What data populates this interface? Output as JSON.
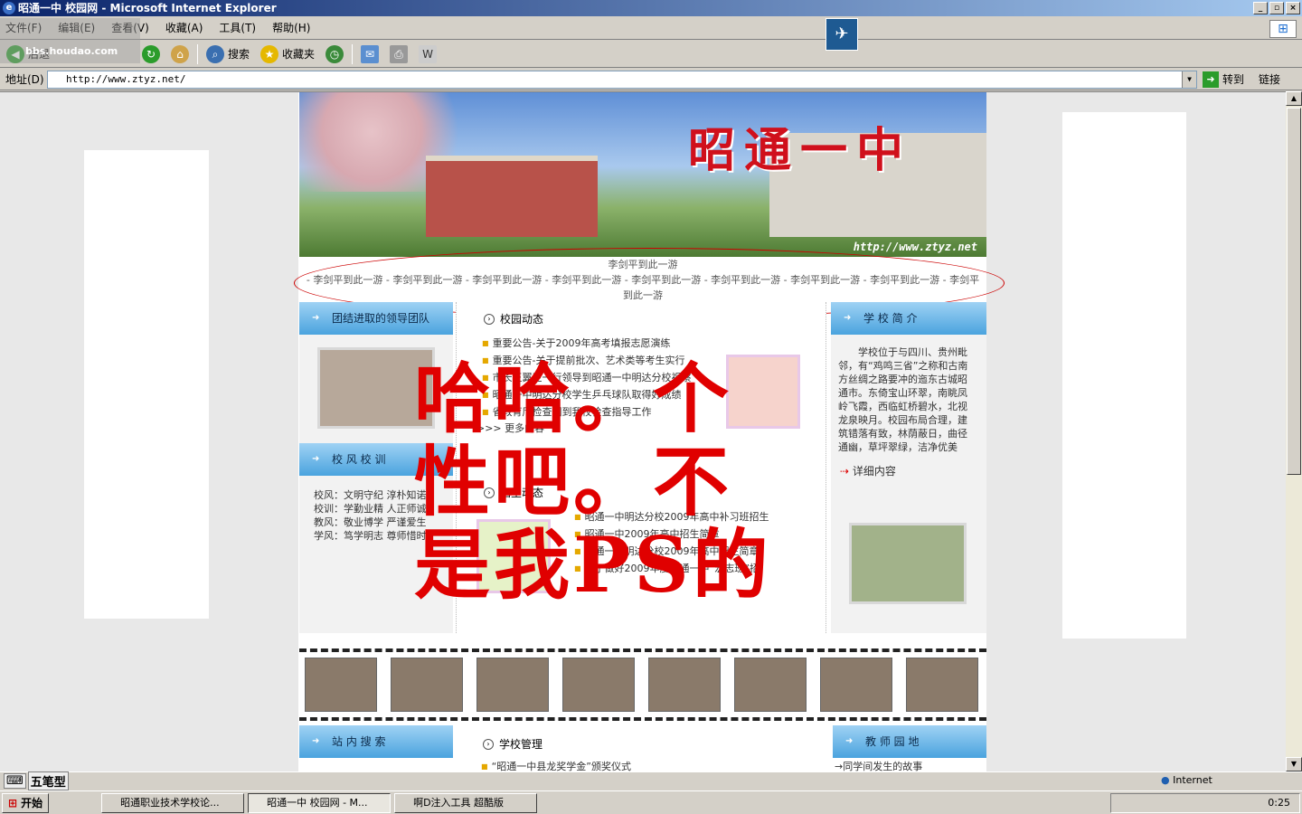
{
  "window": {
    "title": "昭通一中 校园网 - Microsoft Internet Explorer"
  },
  "menu": [
    "文件(F)",
    "编辑(E)",
    "查看(V)",
    "收藏(A)",
    "工具(T)",
    "帮助(H)"
  ],
  "toolbar": {
    "back": "后退",
    "search": "搜索",
    "favorites": "收藏夹"
  },
  "watermark": "bbs.houdao.com",
  "address": {
    "label": "地址(D)",
    "url": "http://www.ztyz.net/",
    "go": "转到",
    "links": "链接"
  },
  "site": {
    "banner_title": "昭通一中",
    "banner_url": "http://www.ztyz.net",
    "marquee_line1": "李剑平到此一游",
    "marquee_line2": "- 李剑平到此一游 - 李剑平到此一游 - 李剑平到此一游 - 李剑平到此一游 - 李剑平到此一游 - 李剑平到此一游 - 李剑平到此一游 - 李剑平到此一游 - 李剑平到此一游",
    "left": {
      "leaders": "团结进取的领导团队",
      "motto_title": "校 风 校 训",
      "motto": [
        "校风：文明守纪 淳朴知诺",
        "校训：学勤业精 人正师诚",
        "教风：敬业博学 严谨爱生",
        "学风：笃学明志 尊师惜时"
      ],
      "search": "站 内 搜 索"
    },
    "middle": {
      "campus_news": "校园动态",
      "news": [
        "重要公告-关于2009年高考填报志愿演练",
        "重要公告-关于提前批次、艺术类等考生实行",
        "市长王翼卫一行领导到昭通一中明达分校视察",
        "昭通一中明达分校学生乒乓球队取得好成绩",
        "省教育厅检查团到我校检查指导工作"
      ],
      "more": ">>> 更多内容",
      "admission": "招生动态",
      "admission_news": [
        "昭通一中明达分校2009年高中补习班招生",
        "昭通一中2009年高中招生简章",
        "昭通一中明达分校2009年高中招生简章",
        "关于做好2009年度昭通一中“宏志班”招"
      ],
      "management": "学校管理",
      "management_news": [
        "“昭通一中县龙奖学金”颁奖仪式"
      ]
    },
    "right": {
      "intro_title": "学 校 简 介",
      "intro": "学校位于与四川、贵州毗邻，有“鸡鸣三省”之称和古南方丝绸之路要冲的迤东古城昭通市。东倚宝山环翠，南眺凤岭飞霞，西临虹桥碧水，北视龙泉映月。校园布局合理，建筑错落有致，林荫蔽日，曲径通幽，草坪翠绿，洁净优美",
      "detail": "详细内容",
      "teachers": "教 师 园 地",
      "teacher_news": "→同学间发生的故事"
    },
    "overlay_text": "哈哈。个性吧。不是我PS的"
  },
  "status": {
    "ime": [
      "五笔型"
    ],
    "zone": "Internet"
  },
  "taskbar": {
    "start": "开始",
    "tasks": [
      "昭通职业技术学校论...",
      "昭通一中 校园网 - M...",
      "啊D注入工具 超酷版"
    ],
    "clock": "0:25"
  }
}
